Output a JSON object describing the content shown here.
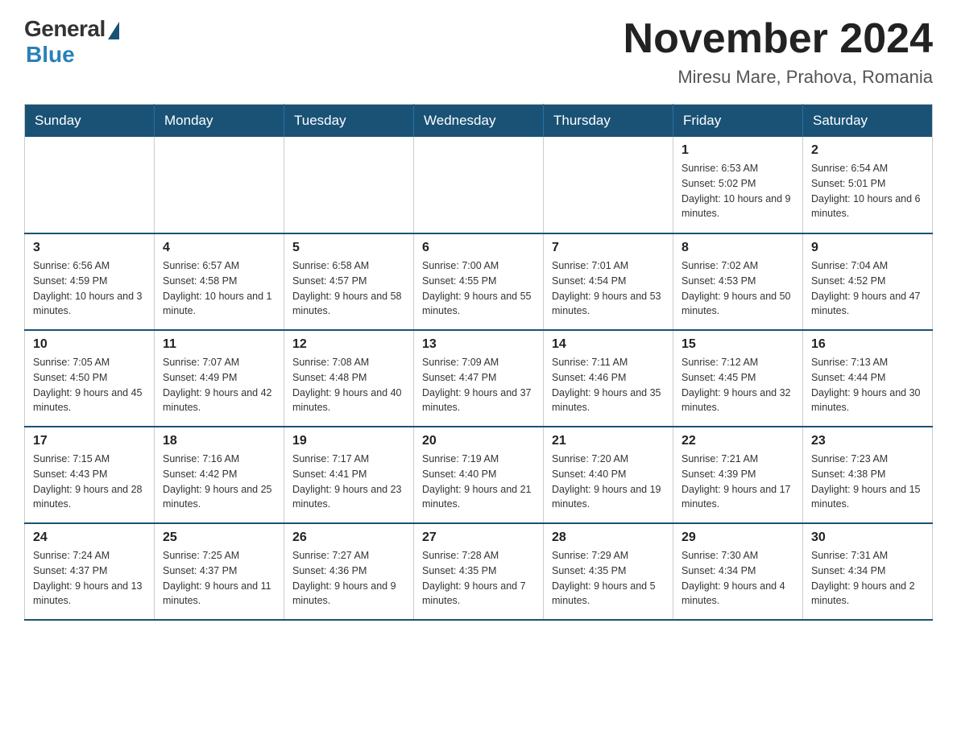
{
  "header": {
    "logo_general": "General",
    "logo_blue": "Blue",
    "month_title": "November 2024",
    "location": "Miresu Mare, Prahova, Romania"
  },
  "calendar": {
    "days_of_week": [
      "Sunday",
      "Monday",
      "Tuesday",
      "Wednesday",
      "Thursday",
      "Friday",
      "Saturday"
    ],
    "weeks": [
      [
        {
          "day": "",
          "info": ""
        },
        {
          "day": "",
          "info": ""
        },
        {
          "day": "",
          "info": ""
        },
        {
          "day": "",
          "info": ""
        },
        {
          "day": "",
          "info": ""
        },
        {
          "day": "1",
          "info": "Sunrise: 6:53 AM\nSunset: 5:02 PM\nDaylight: 10 hours and 9 minutes."
        },
        {
          "day": "2",
          "info": "Sunrise: 6:54 AM\nSunset: 5:01 PM\nDaylight: 10 hours and 6 minutes."
        }
      ],
      [
        {
          "day": "3",
          "info": "Sunrise: 6:56 AM\nSunset: 4:59 PM\nDaylight: 10 hours and 3 minutes."
        },
        {
          "day": "4",
          "info": "Sunrise: 6:57 AM\nSunset: 4:58 PM\nDaylight: 10 hours and 1 minute."
        },
        {
          "day": "5",
          "info": "Sunrise: 6:58 AM\nSunset: 4:57 PM\nDaylight: 9 hours and 58 minutes."
        },
        {
          "day": "6",
          "info": "Sunrise: 7:00 AM\nSunset: 4:55 PM\nDaylight: 9 hours and 55 minutes."
        },
        {
          "day": "7",
          "info": "Sunrise: 7:01 AM\nSunset: 4:54 PM\nDaylight: 9 hours and 53 minutes."
        },
        {
          "day": "8",
          "info": "Sunrise: 7:02 AM\nSunset: 4:53 PM\nDaylight: 9 hours and 50 minutes."
        },
        {
          "day": "9",
          "info": "Sunrise: 7:04 AM\nSunset: 4:52 PM\nDaylight: 9 hours and 47 minutes."
        }
      ],
      [
        {
          "day": "10",
          "info": "Sunrise: 7:05 AM\nSunset: 4:50 PM\nDaylight: 9 hours and 45 minutes."
        },
        {
          "day": "11",
          "info": "Sunrise: 7:07 AM\nSunset: 4:49 PM\nDaylight: 9 hours and 42 minutes."
        },
        {
          "day": "12",
          "info": "Sunrise: 7:08 AM\nSunset: 4:48 PM\nDaylight: 9 hours and 40 minutes."
        },
        {
          "day": "13",
          "info": "Sunrise: 7:09 AM\nSunset: 4:47 PM\nDaylight: 9 hours and 37 minutes."
        },
        {
          "day": "14",
          "info": "Sunrise: 7:11 AM\nSunset: 4:46 PM\nDaylight: 9 hours and 35 minutes."
        },
        {
          "day": "15",
          "info": "Sunrise: 7:12 AM\nSunset: 4:45 PM\nDaylight: 9 hours and 32 minutes."
        },
        {
          "day": "16",
          "info": "Sunrise: 7:13 AM\nSunset: 4:44 PM\nDaylight: 9 hours and 30 minutes."
        }
      ],
      [
        {
          "day": "17",
          "info": "Sunrise: 7:15 AM\nSunset: 4:43 PM\nDaylight: 9 hours and 28 minutes."
        },
        {
          "day": "18",
          "info": "Sunrise: 7:16 AM\nSunset: 4:42 PM\nDaylight: 9 hours and 25 minutes."
        },
        {
          "day": "19",
          "info": "Sunrise: 7:17 AM\nSunset: 4:41 PM\nDaylight: 9 hours and 23 minutes."
        },
        {
          "day": "20",
          "info": "Sunrise: 7:19 AM\nSunset: 4:40 PM\nDaylight: 9 hours and 21 minutes."
        },
        {
          "day": "21",
          "info": "Sunrise: 7:20 AM\nSunset: 4:40 PM\nDaylight: 9 hours and 19 minutes."
        },
        {
          "day": "22",
          "info": "Sunrise: 7:21 AM\nSunset: 4:39 PM\nDaylight: 9 hours and 17 minutes."
        },
        {
          "day": "23",
          "info": "Sunrise: 7:23 AM\nSunset: 4:38 PM\nDaylight: 9 hours and 15 minutes."
        }
      ],
      [
        {
          "day": "24",
          "info": "Sunrise: 7:24 AM\nSunset: 4:37 PM\nDaylight: 9 hours and 13 minutes."
        },
        {
          "day": "25",
          "info": "Sunrise: 7:25 AM\nSunset: 4:37 PM\nDaylight: 9 hours and 11 minutes."
        },
        {
          "day": "26",
          "info": "Sunrise: 7:27 AM\nSunset: 4:36 PM\nDaylight: 9 hours and 9 minutes."
        },
        {
          "day": "27",
          "info": "Sunrise: 7:28 AM\nSunset: 4:35 PM\nDaylight: 9 hours and 7 minutes."
        },
        {
          "day": "28",
          "info": "Sunrise: 7:29 AM\nSunset: 4:35 PM\nDaylight: 9 hours and 5 minutes."
        },
        {
          "day": "29",
          "info": "Sunrise: 7:30 AM\nSunset: 4:34 PM\nDaylight: 9 hours and 4 minutes."
        },
        {
          "day": "30",
          "info": "Sunrise: 7:31 AM\nSunset: 4:34 PM\nDaylight: 9 hours and 2 minutes."
        }
      ]
    ]
  }
}
